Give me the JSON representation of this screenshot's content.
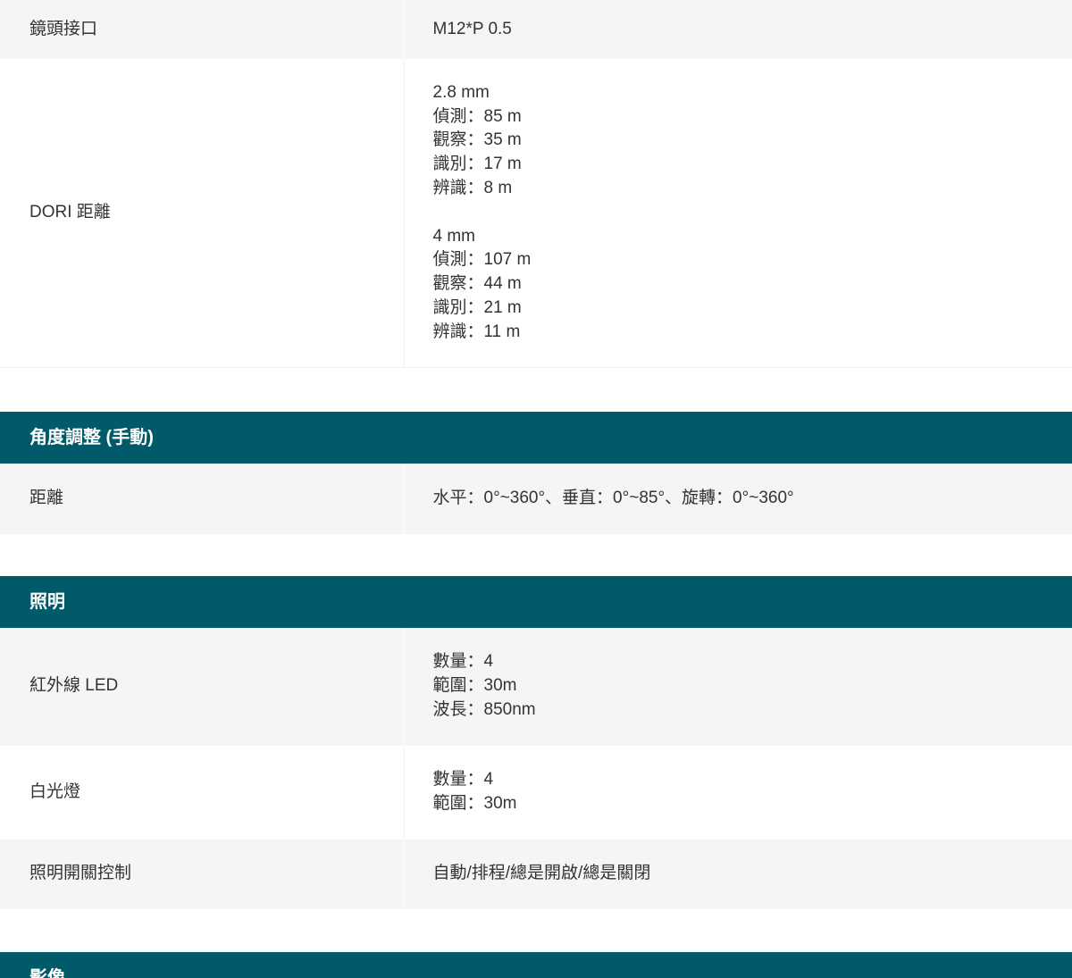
{
  "lens_interface": {
    "label": "鏡頭接口",
    "value": "M12*P 0.5"
  },
  "dori": {
    "label": "DORI 距離",
    "groups": [
      {
        "heading": "2.8 mm",
        "lines": [
          "偵測：85 m",
          "觀察：35 m",
          "識別：17 m",
          "辨識：8 m"
        ]
      },
      {
        "heading": "4 mm",
        "lines": [
          "偵測：107 m",
          "觀察：44 m",
          "識別：21 m",
          "辨識：11 m"
        ]
      }
    ]
  },
  "angle_section": {
    "title": "角度調整 (手動)",
    "rows": [
      {
        "label": "距離",
        "value": "水平：0°~360°、垂直：0°~85°、旋轉：0°~360°"
      }
    ]
  },
  "lighting_section": {
    "title": "照明",
    "ir": {
      "label": "紅外線 LED",
      "lines": [
        "數量：4",
        "範圍：30m",
        "波長：850nm"
      ]
    },
    "white_light": {
      "label": "白光燈",
      "lines": [
        "數量：4",
        "範圍：30m"
      ]
    },
    "switch_control": {
      "label": "照明開關控制",
      "value": "自動/排程/總是開啟/總是關閉"
    }
  },
  "image_section": {
    "title": "影像"
  }
}
